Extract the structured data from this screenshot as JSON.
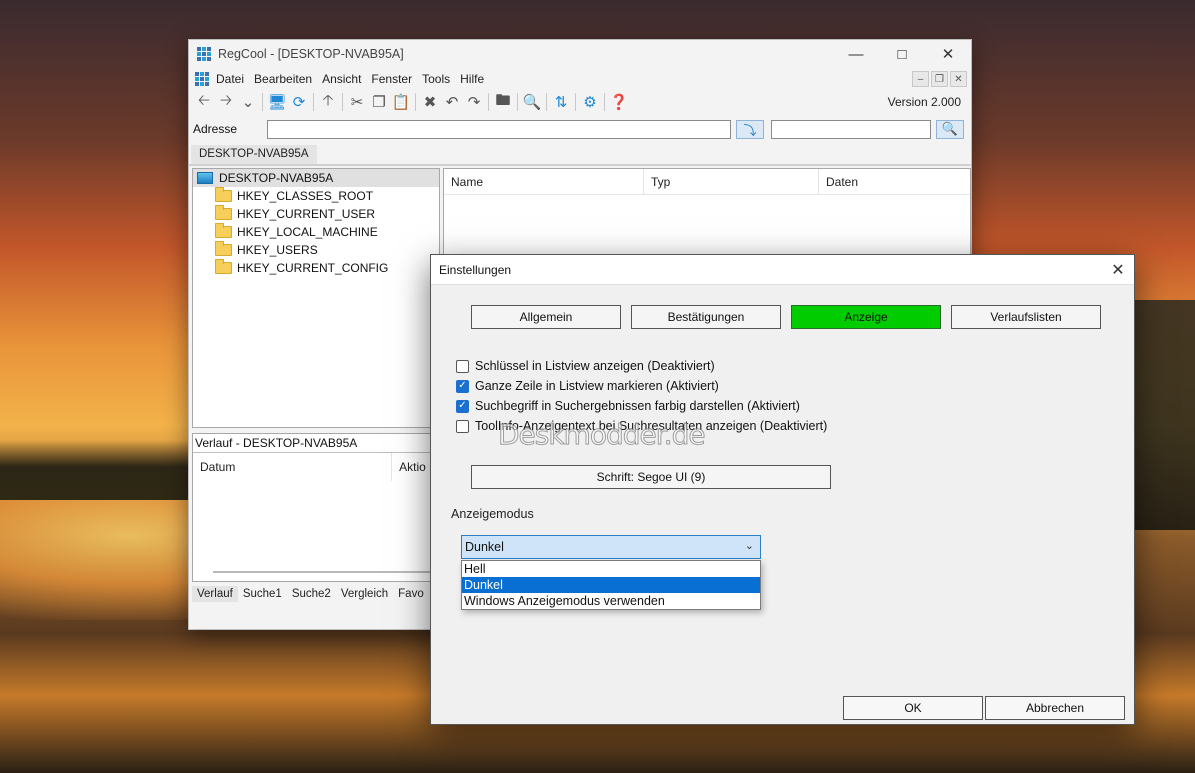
{
  "main_window": {
    "title": "RegCool - [DESKTOP-NVAB95A]",
    "menu": [
      "Datei",
      "Bearbeiten",
      "Ansicht",
      "Fenster",
      "Tools",
      "Hilfe"
    ],
    "version": "Version 2.000",
    "address_label": "Adresse",
    "address_value": "",
    "doc_tab": "DESKTOP-NVAB95A",
    "tree": {
      "root": "DESKTOP-NVAB95A",
      "items": [
        "HKEY_CLASSES_ROOT",
        "HKEY_CURRENT_USER",
        "HKEY_LOCAL_MACHINE",
        "HKEY_USERS",
        "HKEY_CURRENT_CONFIG"
      ]
    },
    "list_columns": [
      "Name",
      "Typ",
      "Daten"
    ],
    "verlauf_title": "Verlauf - DESKTOP-NVAB95A",
    "verlauf_columns": [
      "Datum",
      "Aktio"
    ],
    "bottom_tabs": [
      "Verlauf",
      "Suche1",
      "Suche2",
      "Vergleich",
      "Favo"
    ]
  },
  "dialog": {
    "title": "Einstellungen",
    "tabs": [
      "Allgemein",
      "Bestätigungen",
      "Anzeige",
      "Verlaufslisten"
    ],
    "active_tab": "Anzeige",
    "active_tab_color": "#00cc00",
    "checkboxes": [
      {
        "label": "Schlüssel in Listview anzeigen (Deaktiviert)",
        "checked": false
      },
      {
        "label": "Ganze Zeile in Listview markieren (Aktiviert)",
        "checked": true
      },
      {
        "label": "Suchbegriff in Suchergebnissen farbig darstellen (Aktiviert)",
        "checked": true
      },
      {
        "label": "ToolInfo-Anzeigentext bei Suchresultaten anzeigen  (Deaktiviert)",
        "checked": false
      }
    ],
    "font_button": "Schrift: Segoe UI (9)",
    "mode_label": "Anzeigemodus",
    "mode_selected": "Dunkel",
    "mode_options": [
      "Hell",
      "Dunkel",
      "Windows Anzeigemodus verwenden"
    ],
    "ok": "OK",
    "cancel": "Abbrechen"
  },
  "watermark": "Deskmodder.de"
}
